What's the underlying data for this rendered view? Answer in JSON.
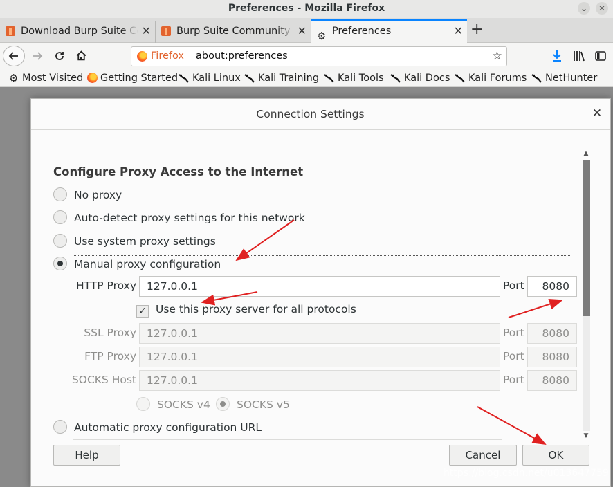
{
  "window": {
    "title": "Preferences - Mozilla Firefox",
    "minimize_glyph": "⌄",
    "close_glyph": "✕"
  },
  "tabs": [
    {
      "label": "Download Burp Suite Community Edition",
      "active": false
    },
    {
      "label": "Burp Suite Community Edition",
      "active": false
    },
    {
      "label": "Preferences",
      "active": true
    }
  ],
  "tab_close_glyph": "✕",
  "new_tab_glyph": "+",
  "nav": {
    "identity_label": "Firefox",
    "url": "about:preferences"
  },
  "bookmarks": [
    {
      "label": "Most Visited",
      "icon": "gear-icon"
    },
    {
      "label": "Getting Started",
      "icon": "firefox-icon"
    },
    {
      "label": "Kali Linux",
      "icon": "kali-dragon-icon"
    },
    {
      "label": "Kali Training",
      "icon": "kali-dragon-icon"
    },
    {
      "label": "Kali Tools",
      "icon": "kali-dragon-icon"
    },
    {
      "label": "Kali Docs",
      "icon": "kali-dragon-icon"
    },
    {
      "label": "Kali Forums",
      "icon": "kali-dragon-icon"
    },
    {
      "label": "NetHunter",
      "icon": "kali-dragon-icon"
    }
  ],
  "dialog": {
    "title": "Connection Settings",
    "close_glyph": "✕",
    "heading": "Configure Proxy Access to the Internet",
    "options": [
      {
        "label": "No proxy",
        "selected": false
      },
      {
        "label": "Auto-detect proxy settings for this network",
        "selected": false
      },
      {
        "label": "Use system proxy settings",
        "selected": false
      },
      {
        "label": "Manual proxy configuration",
        "selected": true
      }
    ],
    "http": {
      "label": "HTTP Proxy",
      "host": "127.0.0.1",
      "port_label": "Port",
      "port": "8080"
    },
    "share_all": {
      "label": "Use this proxy server for all protocols",
      "checked": true,
      "glyph": "✓"
    },
    "ssl": {
      "label": "SSL Proxy",
      "host": "127.0.0.1",
      "port_label": "Port",
      "port": "8080"
    },
    "ftp": {
      "label": "FTP Proxy",
      "host": "127.0.0.1",
      "port_label": "Port",
      "port": "8080"
    },
    "socks": {
      "label": "SOCKS Host",
      "host": "127.0.0.1",
      "port_label": "Port",
      "port": "8080"
    },
    "socks_versions": [
      {
        "label": "SOCKS v4",
        "selected": false
      },
      {
        "label": "SOCKS v5",
        "selected": true
      }
    ],
    "auto_url": {
      "label": "Automatic proxy configuration URL",
      "selected": false
    },
    "buttons": {
      "help": "Help",
      "cancel": "Cancel",
      "ok": "OK"
    }
  },
  "watermark": "https://blog.csdn.net/u013647759",
  "colors": {
    "accent": "#0a84ff",
    "annotation_arrow": "#e02020",
    "firefox_orange": "#e2632e"
  }
}
